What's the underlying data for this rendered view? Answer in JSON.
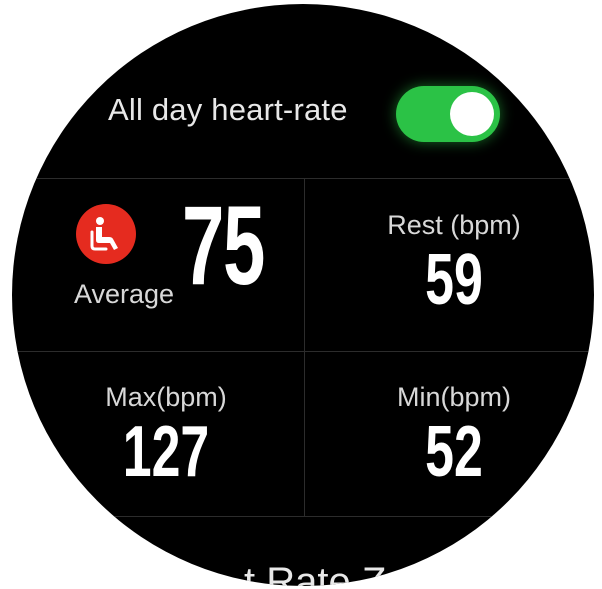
{
  "header": {
    "title": "All day heart-rate",
    "toggle_on": true,
    "toggle_color": "#2bc246"
  },
  "average": {
    "icon": "seated-person-icon",
    "icon_color": "#e52b1f",
    "label": "Average",
    "value": "75"
  },
  "rest": {
    "label": "Rest (bpm)",
    "value": "59"
  },
  "max": {
    "label": "Max(bpm)",
    "value": "127"
  },
  "min": {
    "label": "Min(bpm)",
    "value": "52"
  },
  "next_section": {
    "peek_text": "t Rate Z"
  }
}
